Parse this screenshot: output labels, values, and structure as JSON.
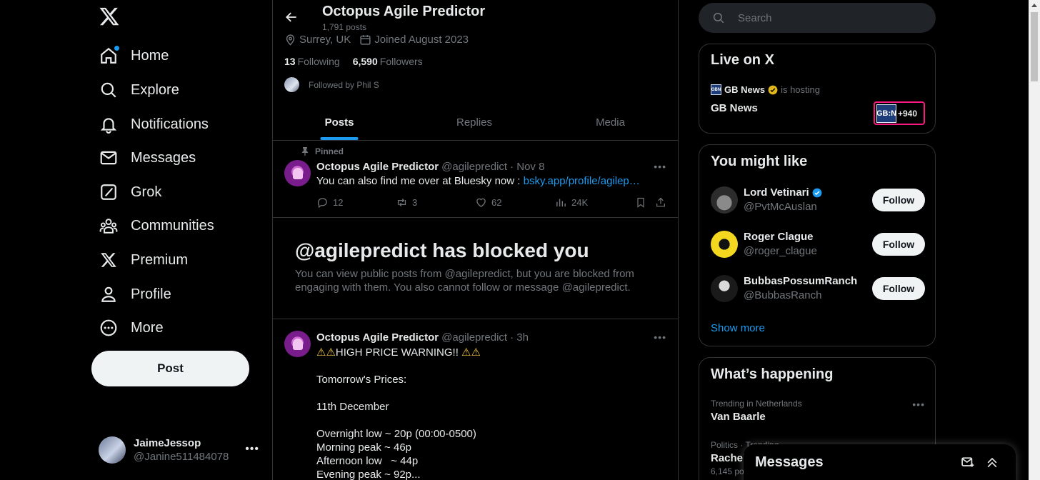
{
  "leftnav": {
    "items": [
      {
        "label": "Home",
        "icon": "home-icon"
      },
      {
        "label": "Explore",
        "icon": "search-icon"
      },
      {
        "label": "Notifications",
        "icon": "bell-icon"
      },
      {
        "label": "Messages",
        "icon": "envelope-icon"
      },
      {
        "label": "Grok",
        "icon": "grok-icon"
      },
      {
        "label": "Communities",
        "icon": "communities-icon"
      },
      {
        "label": "Premium",
        "icon": "x-logo-icon"
      },
      {
        "label": "Profile",
        "icon": "person-icon"
      },
      {
        "label": "More",
        "icon": "more-circle-icon"
      }
    ],
    "post_label": "Post",
    "account": {
      "name": "JaimeJessop",
      "handle": "@Janine511484078"
    }
  },
  "header": {
    "title": "Octopus Agile Predictor",
    "posts_count": "1,791 posts",
    "location": "Surrey, UK",
    "joined": "Joined August 2023",
    "following_count": "13",
    "following_label": "Following",
    "followers_count": "6,590",
    "followers_label": "Followers",
    "followed_by": "Followed by Phil S"
  },
  "tabs": [
    "Posts",
    "Replies",
    "Media"
  ],
  "pinned_tweet": {
    "pinned_label": "Pinned",
    "name": "Octopus Agile Predictor",
    "handle": "@agilepredict",
    "date": "· Nov 8",
    "text": "You can also find me over at Bluesky now : ",
    "link": "bsky.app/profile/agilep…",
    "replies": "12",
    "reposts": "3",
    "likes": "62",
    "views": "24K"
  },
  "blocked": {
    "title": "@agilepredict has blocked you",
    "body": "You can view public posts from @agilepredict, but you are blocked from engaging with them. You also cannot follow or message @agilepredict."
  },
  "tweet2": {
    "name": "Octopus Agile Predictor",
    "handle": "@agilepredict",
    "time": "· 3h",
    "warning_line": "HIGH PRICE WARNING!!",
    "lines": [
      "Tomorrow's Prices:",
      "11th December",
      "Overnight low ~ 20p (00:00-0500)",
      "Morning peak ~ 46p",
      "Afternoon low   ~ 44p",
      "Evening peak ~ 92p..."
    ]
  },
  "search": {
    "placeholder": "Search"
  },
  "live": {
    "title": "Live on X",
    "host_name": "GB News",
    "hosting": "is hosting",
    "show": "GB News",
    "badge_logo": "GB:N",
    "listeners": "+940"
  },
  "might_like": {
    "title": "You might like",
    "people": [
      {
        "name": "Lord Vetinari",
        "handle": "@PvtMcAuslan",
        "verified": true,
        "button": "Follow"
      },
      {
        "name": "Roger Clague",
        "handle": "@roger_clague",
        "verified": false,
        "button": "Follow"
      },
      {
        "name": "BubbasPossumRanch",
        "handle": "@BubbasRanch",
        "verified": false,
        "button": "Follow"
      }
    ],
    "show_more": "Show more"
  },
  "happening": {
    "title": "What’s happening",
    "trends": [
      {
        "context": "Trending in Netherlands",
        "name": "Van Baarle",
        "posts": ""
      },
      {
        "context": "Politics · Trending",
        "name": "Rachel",
        "posts": "6,145 po"
      }
    ]
  },
  "messages_drawer": {
    "title": "Messages"
  },
  "colors": {
    "accent": "#1d9bf0",
    "background": "#000000",
    "text": "#e7e9ea",
    "muted": "#71767b",
    "border": "#2f3336"
  }
}
